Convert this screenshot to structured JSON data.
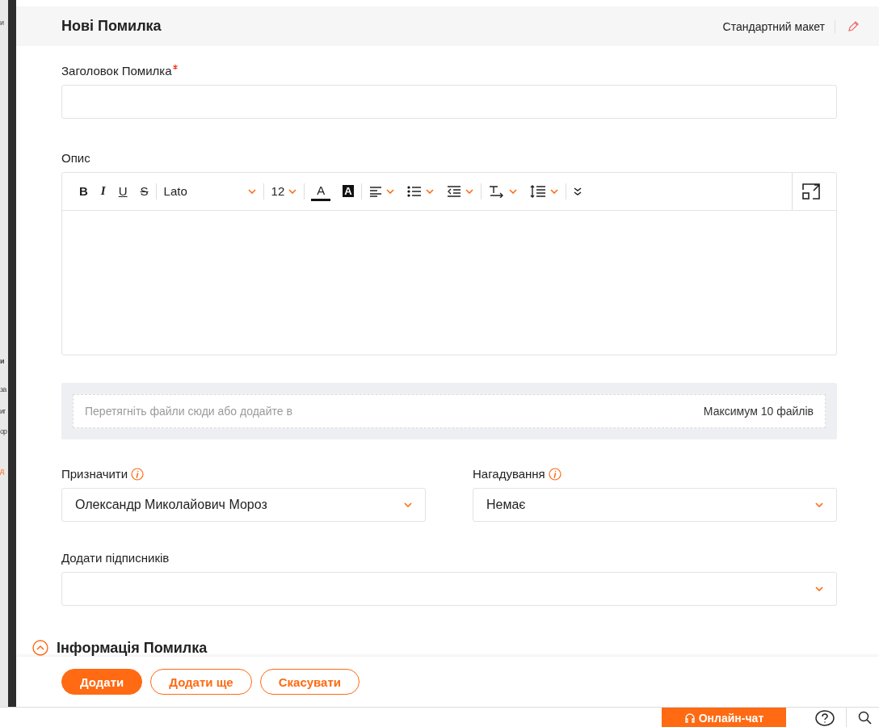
{
  "backdrop": {
    "fragments": [
      {
        "text": "и",
        "kind": "plain"
      },
      {
        "text": "и",
        "kind": "heading"
      },
      {
        "text": "за",
        "kind": "plain"
      },
      {
        "text": "иг",
        "kind": "plain"
      },
      {
        "text": "ор",
        "kind": "plain"
      },
      {
        "text": "д",
        "kind": "link"
      }
    ]
  },
  "dialog": {
    "title": "Нові Помилка",
    "layout": "Стандартний макет"
  },
  "title_field": {
    "label": "Заголовок Помилка",
    "required": true
  },
  "description": {
    "label": "Опис",
    "toolbar": [
      {
        "kind": "bold",
        "text": "B"
      },
      {
        "kind": "italic",
        "text": "I"
      },
      {
        "kind": "underline",
        "text": "U"
      },
      {
        "kind": "strike",
        "text": "S"
      },
      {
        "kind": "font",
        "text": "Lato"
      },
      {
        "kind": "size",
        "text": "12"
      },
      {
        "kind": "color",
        "text": "A"
      },
      {
        "kind": "highlight",
        "text": "A"
      },
      {
        "kind": "align"
      },
      {
        "kind": "list"
      },
      {
        "kind": "indent"
      },
      {
        "kind": "direction"
      },
      {
        "kind": "lineheight"
      },
      {
        "kind": "more"
      },
      {
        "kind": "expand"
      }
    ]
  },
  "attachments": {
    "placeholder": "Перетягніть файли сюди або додайте в",
    "limit": "Максимум 10 файлів"
  },
  "selects": [
    {
      "label": "Призначити",
      "info": true,
      "value": "Олександр Миколайович Мороз"
    },
    {
      "label": "Нагадування",
      "info": true,
      "value": "Немає"
    }
  ],
  "subscribers": {
    "label": "Додати підписників"
  },
  "section": {
    "title": "Інформація Помилка",
    "expanded": true
  },
  "buttons": [
    {
      "label": "Додати",
      "kind": "primary"
    },
    {
      "label": "Додати ще",
      "kind": "outline"
    },
    {
      "label": "Скасувати",
      "kind": "outline"
    }
  ],
  "bottom_bar": {
    "chat": "Онлайн-чат"
  }
}
